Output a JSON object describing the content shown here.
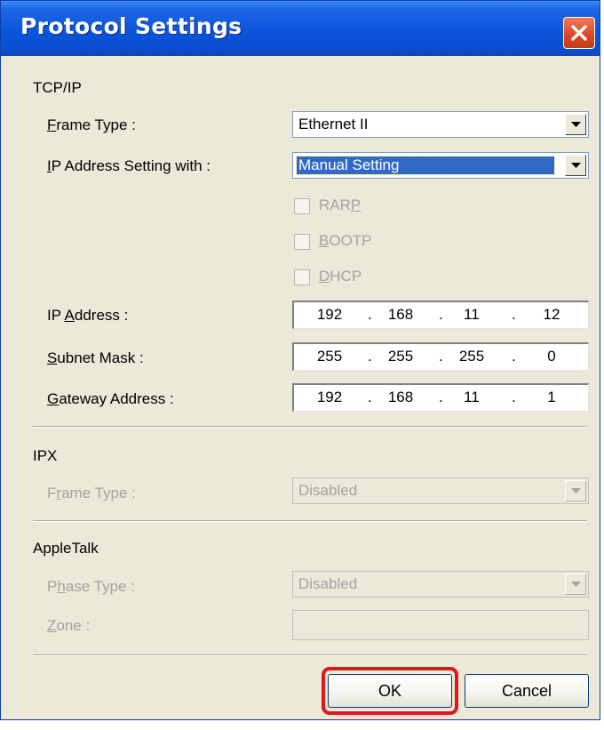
{
  "window": {
    "title": "Protocol Settings"
  },
  "tcpip": {
    "section_title": "TCP/IP",
    "frame_type": {
      "label_accesskey": "F",
      "label_rest": "rame Type :",
      "value": "Ethernet II"
    },
    "ip_setting": {
      "label_accesskey": "I",
      "label_rest": "P Address Setting with :",
      "value": "Manual Setting"
    },
    "checkboxes": [
      {
        "label_pre": "RAR",
        "label_accesskey": "P",
        "label_post": "",
        "checked": false,
        "enabled": false
      },
      {
        "label_pre": "",
        "label_accesskey": "B",
        "label_post": "OOTP",
        "checked": false,
        "enabled": false
      },
      {
        "label_pre": "",
        "label_accesskey": "D",
        "label_post": "HCP",
        "checked": false,
        "enabled": false
      }
    ],
    "ip_address": {
      "label_pre": "IP ",
      "label_accesskey": "A",
      "label_post": "ddress :",
      "octets": [
        "192",
        "168",
        "11",
        "12"
      ]
    },
    "subnet_mask": {
      "label_accesskey": "S",
      "label_rest": "ubnet Mask :",
      "octets": [
        "255",
        "255",
        "255",
        "0"
      ]
    },
    "gateway": {
      "label_accesskey": "G",
      "label_rest": "ateway Address :",
      "octets": [
        "192",
        "168",
        "11",
        "1"
      ]
    },
    "octet_separator": "."
  },
  "ipx": {
    "section_title": "IPX",
    "frame_type": {
      "label_pre": "F",
      "label_accesskey": "r",
      "label_post": "ame Type :",
      "value": "Disabled"
    }
  },
  "appletalk": {
    "section_title": "AppleTalk",
    "phase_type": {
      "label_pre": "P",
      "label_accesskey": "h",
      "label_post": "ase Type :",
      "value": "Disabled"
    },
    "zone": {
      "label_accesskey": "Z",
      "label_rest": "one :",
      "value": ""
    }
  },
  "buttons": {
    "ok_label": "OK",
    "cancel_label": "Cancel"
  },
  "colors": {
    "titlebar": "#0a55dc",
    "close_button": "#dc4a26",
    "dialog_background": "#ece9d8",
    "selection": "#316ac5",
    "disabled_text": "#a3a3a3",
    "highlight_annotation": "#e01818"
  },
  "icons": {
    "close": "close-icon",
    "dropdown": "chevron-down-icon"
  }
}
